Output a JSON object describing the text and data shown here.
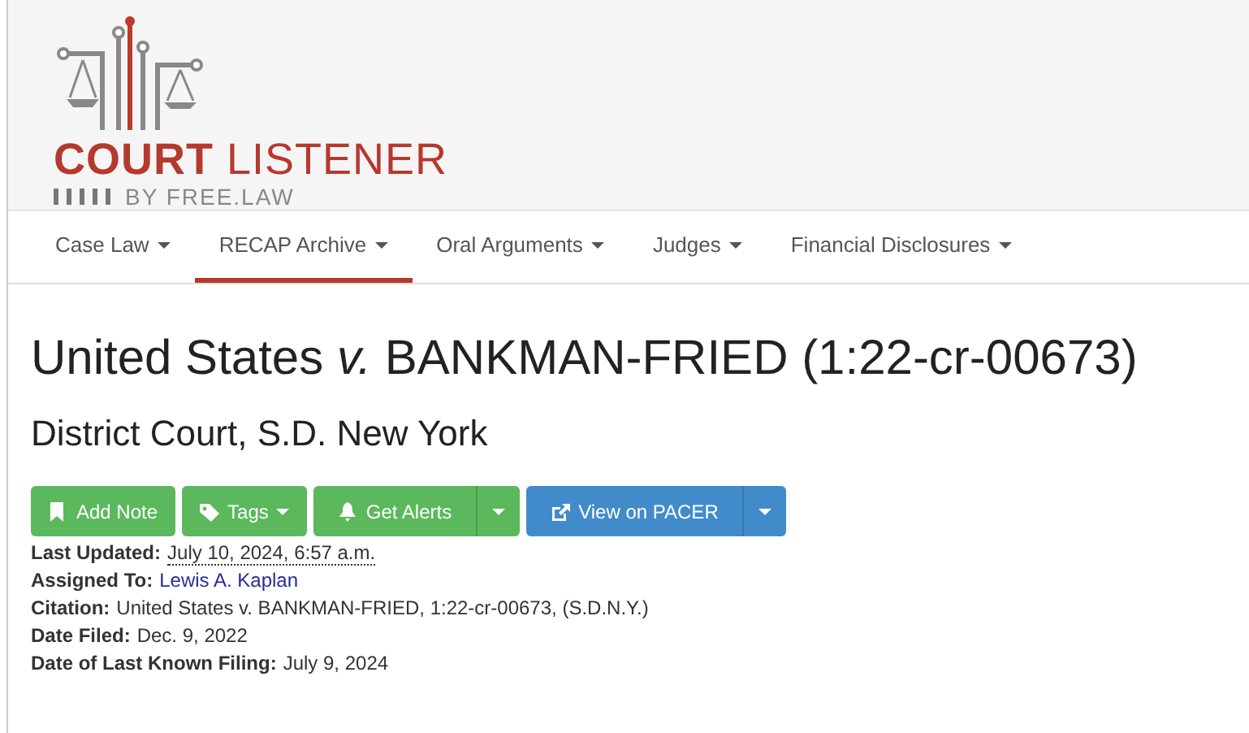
{
  "logo": {
    "title": "**COURT** LISTENER",
    "subtitle": "BY FREE.LAW"
  },
  "nav": [
    {
      "label": "Case Law",
      "selected": false
    },
    {
      "label": "RECAP Archive",
      "selected": true
    },
    {
      "label": "Oral Arguments",
      "selected": false
    },
    {
      "label": "Judges",
      "selected": false
    },
    {
      "label": "Financial Disclosures",
      "selected": false
    }
  ],
  "case": {
    "title": "United States *v.* BANKMAN-FRIED (1:22-cr-00673)",
    "court": "District Court, S.D. New York"
  },
  "buttons": [
    {
      "label": "Add Note",
      "kind": "plain",
      "color": "#5cb85c"
    },
    {
      "label": "Tags",
      "kind": "caret",
      "color": "#5cb85c"
    },
    {
      "label": "Get Alerts",
      "kind": "split",
      "color": "#5cb85c"
    },
    {
      "label": "View on PACER",
      "kind": "split",
      "color": "#428bca"
    }
  ],
  "details": [
    {
      "label": "Last Updated:",
      "value": "July 10, 2024, 6:57 a.m.",
      "kind": "time"
    },
    {
      "label": "Assigned To:",
      "value": "Lewis A. Kaplan",
      "kind": "link"
    },
    {
      "label": "Citation:",
      "value": "United States v. BANKMAN-FRIED, 1:22-cr-00673, (S.D.N.Y.)",
      "kind": "text"
    },
    {
      "label": "Date Filed:",
      "value": "Dec. 9, 2022",
      "kind": "text"
    },
    {
      "label": "Date of Last Known Filing:",
      "value": "July 9, 2024",
      "kind": "text"
    }
  ]
}
